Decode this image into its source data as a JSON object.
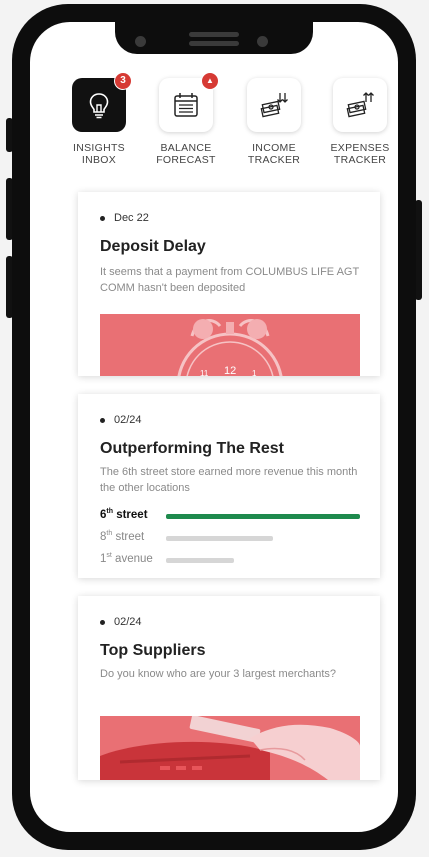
{
  "tabs": [
    {
      "label": "INSIGHTS\nINBOX",
      "icon": "lightbulb-icon",
      "badge": "3"
    },
    {
      "label": "BALANCE\nFORECAST",
      "icon": "calendar-icon",
      "badge": ""
    },
    {
      "label": "INCOME\nTRACKER",
      "icon": "money-down-icon"
    },
    {
      "label": "EXPENSES\nTRACKER",
      "icon": "money-up-icon"
    }
  ],
  "cards": [
    {
      "date": "Dec 22",
      "title": "Deposit Delay",
      "description": "It seems that a payment from COLUMBUS LIFE AGT COMM hasn't been deposited",
      "image_icon": "alarm-clock-icon"
    },
    {
      "date": "02/24",
      "title": "Outperforming The Rest",
      "description": "The 6th street store earned more revenue this month the other locations",
      "bars": [
        {
          "ordinal": "6",
          "suffix": "th",
          "name": " street",
          "value": 1.0,
          "color": "#1e8a4d"
        },
        {
          "ordinal": "8",
          "suffix": "th",
          "name": " street",
          "value": 0.55,
          "color": "#d6d6d6"
        },
        {
          "ordinal": "1",
          "suffix": "st",
          "name": " avenue",
          "value": 0.35,
          "color": "#d6d6d6"
        }
      ]
    },
    {
      "date": "02/24",
      "title": "Top Suppliers",
      "description": "Do you know who are your 3 largest merchants?",
      "image_icon": "card-payment-icon"
    }
  ],
  "colors": {
    "accent": "#d63a34",
    "bar_positive": "#1e8a4d",
    "image_tint": "#e97074"
  }
}
